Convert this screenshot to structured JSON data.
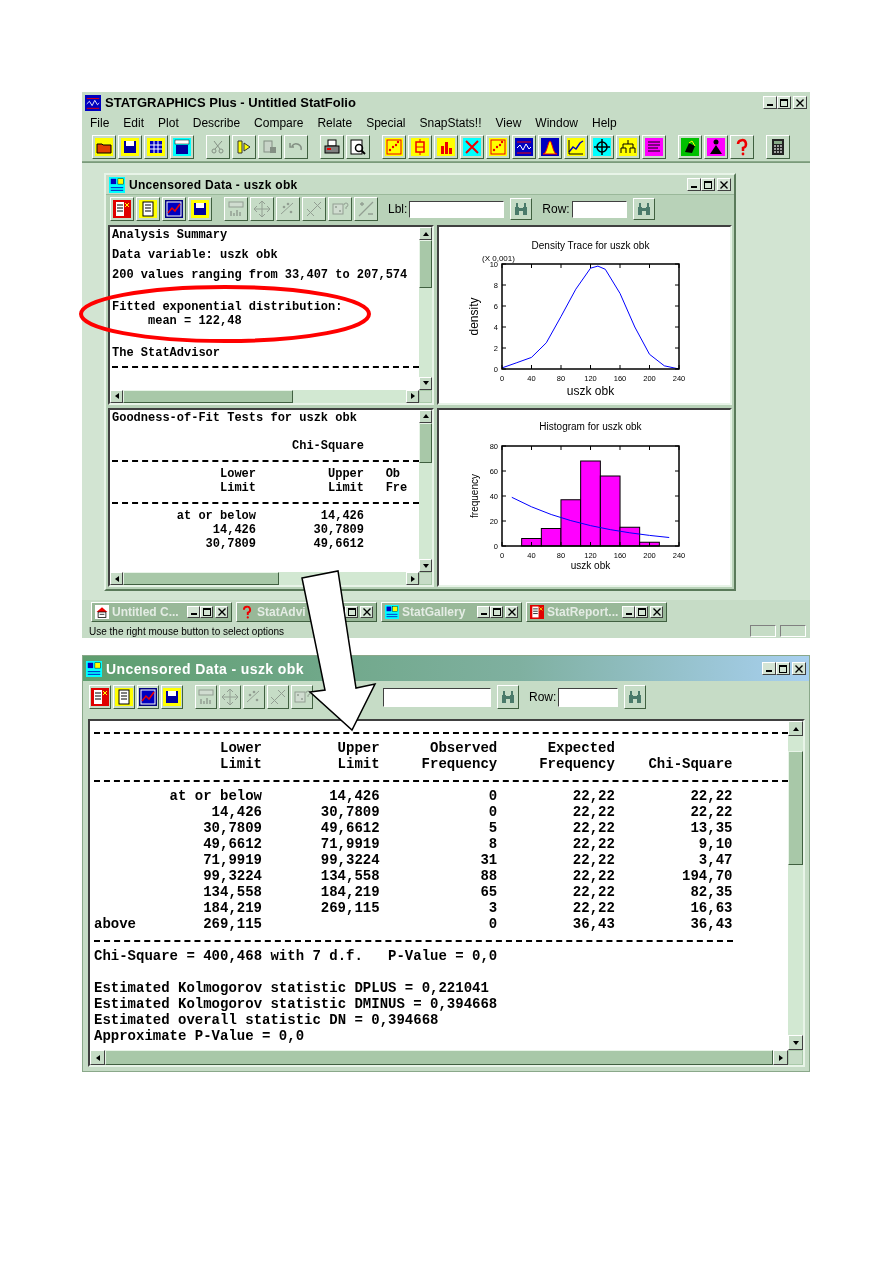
{
  "main_window": {
    "title": "STATGRAPHICS Plus - Untitled StatFolio",
    "active": false,
    "menu": [
      "File",
      "Edit",
      "Plot",
      "Describe",
      "Compare",
      "Relate",
      "Special",
      "SnapStats!!",
      "View",
      "Window",
      "Help"
    ],
    "toolbar": [
      {
        "disabled": false
      },
      {
        "disabled": false
      },
      {
        "disabled": false
      },
      {
        "disabled": false
      },
      {
        "disabled": true
      },
      {
        "disabled": false
      },
      {
        "disabled": true
      },
      {
        "disabled": true
      },
      {
        "disabled": false
      },
      {
        "disabled": false
      },
      {
        "disabled": false
      },
      {
        "disabled": false
      },
      {
        "disabled": false
      },
      {
        "disabled": false
      },
      {
        "disabled": false
      },
      {
        "disabled": false
      },
      {
        "disabled": false
      },
      {
        "disabled": false
      },
      {
        "disabled": false
      },
      {
        "disabled": false
      },
      {
        "disabled": false
      },
      {
        "disabled": false
      },
      {
        "disabled": false
      },
      {
        "disabled": false
      },
      {
        "disabled": false
      }
    ],
    "analysis_window": {
      "title": "Uncensored Data - uszk obk",
      "active": false,
      "toolbar": [
        {
          "disabled": false
        },
        {
          "disabled": false
        },
        {
          "disabled": false
        },
        {
          "disabled": false
        },
        {
          "disabled": true
        },
        {
          "disabled": true
        },
        {
          "disabled": true
        },
        {
          "disabled": true
        },
        {
          "disabled": true
        },
        {
          "disabled": true
        }
      ],
      "label_field": {
        "label": "Lbl:"
      },
      "row_field": {
        "label": "Row:"
      },
      "summary_pane": {
        "blocks": [
          {
            "kind": "text",
            "text": "Analysis Summary"
          },
          {
            "kind": "text",
            "text": "Data variable: uszk obk"
          },
          {
            "kind": "text",
            "text": "200 values ranging from 33,407 to 207,574"
          },
          {
            "kind": "text",
            "text": "Fitted exponential distribution:",
            "children": [
              {
                "text": "mean = 122,48"
              }
            ]
          },
          {
            "kind": "heading",
            "text": "The StatAdvisor"
          }
        ]
      },
      "density_pane": {
        "scale_note": "(X 0,001)",
        "chart_data": {
          "type": "line",
          "title": "Density Trace for uszk obk",
          "xlabel": "uszk obk",
          "ylabel": "density",
          "x": [
            0,
            20,
            40,
            60,
            80,
            100,
            120,
            130,
            140,
            160,
            180,
            200,
            220,
            240
          ],
          "series": [
            {
              "color": "#0000ff",
              "values": [
                0.1,
                0.6,
                1.1,
                2.5,
                5.0,
                7.6,
                9.6,
                9.8,
                9.5,
                7.2,
                4.0,
                1.4,
                0.3,
                0.0
              ]
            }
          ],
          "xlim": [
            0,
            240
          ],
          "ylim": [
            0,
            10
          ],
          "xticks": [
            0,
            40,
            80,
            120,
            160,
            200,
            240
          ],
          "yticks": [
            0,
            2,
            4,
            6,
            8,
            10
          ]
        }
      },
      "goodness_pane": {
        "title": "Goodness-of-Fit Tests for uszk obk",
        "column_note": "Chi-Square",
        "columns": [
          {
            "lines": [
              "Lower",
              "Limit"
            ]
          },
          {
            "lines": [
              "Upper",
              "Limit"
            ]
          },
          {
            "lines": [
              "Ob",
              "Fre"
            ]
          }
        ],
        "rows": [
          {
            "lower": "at or below",
            "upper": "14,426"
          },
          {
            "lower": "14,426",
            "upper": "30,7809"
          },
          {
            "lower": "30,7809",
            "upper": "49,6612"
          }
        ]
      },
      "histogram_pane": {
        "chart_data": {
          "type": "bar",
          "title": "Histogram for uszk obk",
          "xlabel": "uszk obk",
          "ylabel": "frequency",
          "x": [
            13.3,
            40,
            66.7,
            93.3,
            120,
            146.7,
            173.3,
            200,
            226.7
          ],
          "series": [
            {
              "color": "#ff00ff",
              "values": [
                0,
                6,
                14,
                37,
                68,
                56,
                15,
                3,
                0
              ]
            },
            {
              "type": "line",
              "color": "#0000ff",
              "values": [
                39.0,
                31.4,
                25.2,
                20.3,
                16.3,
                13.1,
                10.6,
                8.5,
                6.8
              ]
            }
          ],
          "xlim": [
            0,
            240
          ],
          "ylim": [
            0,
            80
          ],
          "xticks": [
            0,
            40,
            80,
            120,
            160,
            200,
            240
          ],
          "yticks": [
            0,
            20,
            40,
            60,
            80
          ]
        }
      }
    },
    "taskbar": [
      {
        "title": "Untitled C..."
      },
      {
        "title": "StatAdvi"
      },
      {
        "title": "StatGallery"
      },
      {
        "title": "StatReport..."
      }
    ],
    "status_bar": "Use the right mouse button to select options"
  },
  "report_window": {
    "title": "Uncensored Data - uszk obk",
    "active": true,
    "toolbar": [
      {
        "disabled": false
      },
      {
        "disabled": false
      },
      {
        "disabled": false
      },
      {
        "disabled": false
      },
      {
        "disabled": true
      },
      {
        "disabled": true
      },
      {
        "disabled": true
      },
      {
        "disabled": true
      },
      {
        "disabled": true
      }
    ],
    "row_field": {
      "label": "Row:"
    },
    "columns": [
      {
        "lines": [
          "Lower",
          "Limit"
        ]
      },
      {
        "lines": [
          "Upper",
          "Limit"
        ]
      },
      {
        "lines": [
          "Observed",
          "Frequency"
        ]
      },
      {
        "lines": [
          "Expected",
          "Frequency"
        ]
      },
      {
        "lines": [
          "Chi-Square"
        ]
      }
    ],
    "rows": [
      {
        "lower": "at or below",
        "upper": "14,426",
        "observed": "0",
        "expected": "22,22",
        "chi_square": "22,22"
      },
      {
        "lower": "14,426",
        "upper": "30,7809",
        "observed": "0",
        "expected": "22,22",
        "chi_square": "22,22"
      },
      {
        "lower": "30,7809",
        "upper": "49,6612",
        "observed": "5",
        "expected": "22,22",
        "chi_square": "13,35"
      },
      {
        "lower": "49,6612",
        "upper": "71,9919",
        "observed": "8",
        "expected": "22,22",
        "chi_square": "9,10"
      },
      {
        "lower": "71,9919",
        "upper": "99,3224",
        "observed": "31",
        "expected": "22,22",
        "chi_square": "3,47"
      },
      {
        "lower": "99,3224",
        "upper": "134,558",
        "observed": "88",
        "expected": "22,22",
        "chi_square": "194,70"
      },
      {
        "lower": "134,558",
        "upper": "184,219",
        "observed": "65",
        "expected": "22,22",
        "chi_square": "82,35"
      },
      {
        "lower": "184,219",
        "upper": "269,115",
        "observed": "3",
        "expected": "22,22",
        "chi_square": "16,63"
      },
      {
        "label": "above",
        "lower": "269,115",
        "observed": "0",
        "expected": "36,43",
        "chi_square": "36,43"
      }
    ],
    "test_result": "Chi-Square = 400,468 with 7 d.f.   P-Value = 0,0",
    "statistics": [
      "Estimated Kolmogorov statistic DPLUS = 0,221041",
      "Estimated Kolmogorov statistic DMINUS = 0,394668",
      "Estimated overall statistic DN = 0,394668",
      "Approximate P-Value = 0,0"
    ]
  }
}
